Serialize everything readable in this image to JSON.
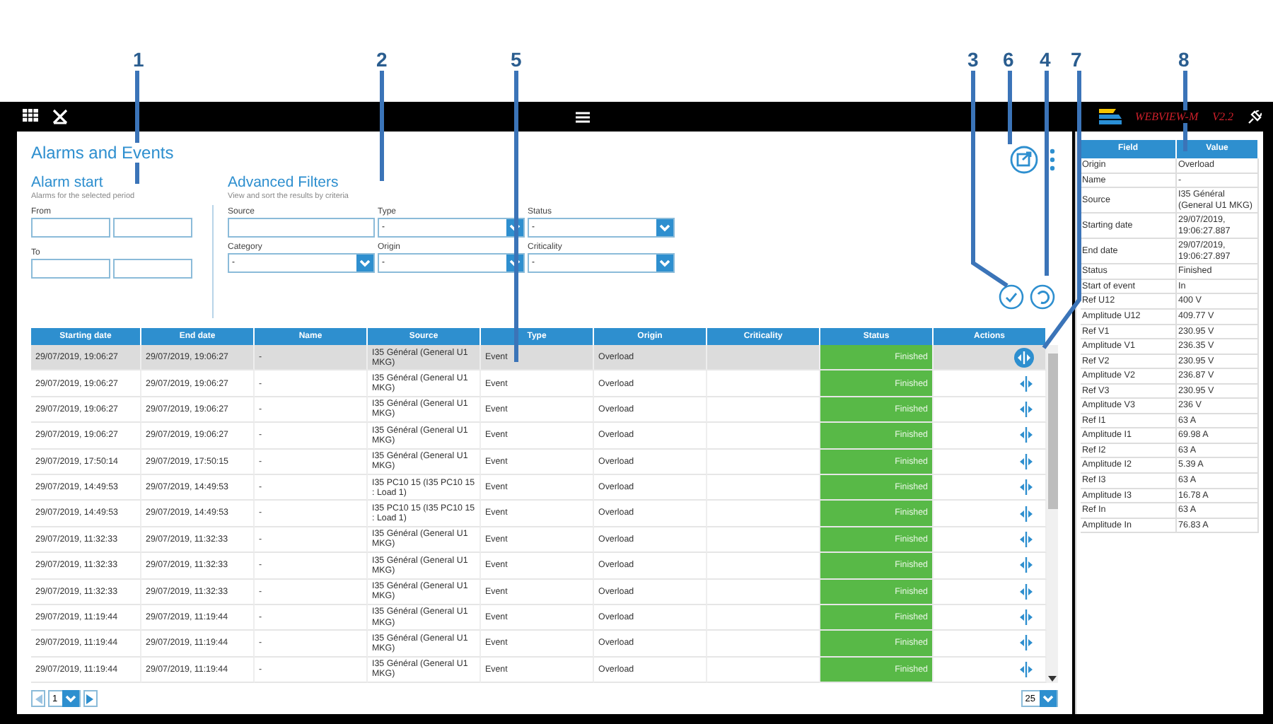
{
  "callouts": [
    "1",
    "2",
    "5",
    "3",
    "6",
    "4",
    "7",
    "8"
  ],
  "topbar": {
    "brand": "WEBVIEW-M",
    "version": "V2.2"
  },
  "title": "Alarms and Events",
  "alarm_start": {
    "title": "Alarm start",
    "subtitle": "Alarms for the selected period",
    "from_label": "From",
    "to_label": "To"
  },
  "filters": {
    "title": "Advanced Filters",
    "subtitle": "View and sort the results by criteria",
    "fields": [
      {
        "label": "Source",
        "kind": "text"
      },
      {
        "label": "Type",
        "kind": "select",
        "value": "-"
      },
      {
        "label": "Status",
        "kind": "select",
        "value": "-"
      },
      {
        "label": "Category",
        "kind": "select",
        "value": "-"
      },
      {
        "label": "Origin",
        "kind": "select",
        "value": "-"
      },
      {
        "label": "Criticality",
        "kind": "select",
        "value": "-"
      }
    ]
  },
  "table": {
    "columns": [
      "Starting date",
      "End date",
      "Name",
      "Source",
      "Type",
      "Origin",
      "Criticality",
      "Status",
      "Actions"
    ],
    "rows": [
      {
        "selected": true,
        "start": "29/07/2019, 19:06:27",
        "end": "29/07/2019, 19:06:27",
        "name": "-",
        "source": "I35 Général (General U1 MKG)",
        "type": "Event",
        "origin": "Overload",
        "status": "Finished"
      },
      {
        "selected": false,
        "start": "29/07/2019, 19:06:27",
        "end": "29/07/2019, 19:06:27",
        "name": "-",
        "source": "I35 Général (General U1 MKG)",
        "type": "Event",
        "origin": "Overload",
        "status": "Finished"
      },
      {
        "selected": false,
        "start": "29/07/2019, 19:06:27",
        "end": "29/07/2019, 19:06:27",
        "name": "-",
        "source": "I35 Général (General U1 MKG)",
        "type": "Event",
        "origin": "Overload",
        "status": "Finished"
      },
      {
        "selected": false,
        "start": "29/07/2019, 19:06:27",
        "end": "29/07/2019, 19:06:27",
        "name": "-",
        "source": "I35 Général (General U1 MKG)",
        "type": "Event",
        "origin": "Overload",
        "status": "Finished"
      },
      {
        "selected": false,
        "start": "29/07/2019, 17:50:14",
        "end": "29/07/2019, 17:50:15",
        "name": "-",
        "source": "I35 Général (General U1 MKG)",
        "type": "Event",
        "origin": "Overload",
        "status": "Finished"
      },
      {
        "selected": false,
        "start": "29/07/2019, 14:49:53",
        "end": "29/07/2019, 14:49:53",
        "name": "-",
        "source": "I35 PC10 15 (I35 PC10 15 : Load 1)",
        "type": "Event",
        "origin": "Overload",
        "status": "Finished"
      },
      {
        "selected": false,
        "start": "29/07/2019, 14:49:53",
        "end": "29/07/2019, 14:49:53",
        "name": "-",
        "source": "I35 PC10 15 (I35 PC10 15 : Load 1)",
        "type": "Event",
        "origin": "Overload",
        "status": "Finished"
      },
      {
        "selected": false,
        "start": "29/07/2019, 11:32:33",
        "end": "29/07/2019, 11:32:33",
        "name": "-",
        "source": "I35 Général (General U1 MKG)",
        "type": "Event",
        "origin": "Overload",
        "status": "Finished"
      },
      {
        "selected": false,
        "start": "29/07/2019, 11:32:33",
        "end": "29/07/2019, 11:32:33",
        "name": "-",
        "source": "I35 Général (General U1 MKG)",
        "type": "Event",
        "origin": "Overload",
        "status": "Finished"
      },
      {
        "selected": false,
        "start": "29/07/2019, 11:32:33",
        "end": "29/07/2019, 11:32:33",
        "name": "-",
        "source": "I35 Général (General U1 MKG)",
        "type": "Event",
        "origin": "Overload",
        "status": "Finished"
      },
      {
        "selected": false,
        "start": "29/07/2019, 11:19:44",
        "end": "29/07/2019, 11:19:44",
        "name": "-",
        "source": "I35 Général (General U1 MKG)",
        "type": "Event",
        "origin": "Overload",
        "status": "Finished"
      },
      {
        "selected": false,
        "start": "29/07/2019, 11:19:44",
        "end": "29/07/2019, 11:19:44",
        "name": "-",
        "source": "I35 Général (General U1 MKG)",
        "type": "Event",
        "origin": "Overload",
        "status": "Finished"
      },
      {
        "selected": false,
        "start": "29/07/2019, 11:19:44",
        "end": "29/07/2019, 11:19:44",
        "name": "-",
        "source": "I35 Général (General U1 MKG)",
        "type": "Event",
        "origin": "Overload",
        "status": "Finished"
      }
    ]
  },
  "pager": {
    "page": "1",
    "page_size": "25"
  },
  "details": {
    "columns": [
      "Field",
      "Value"
    ],
    "rows": [
      [
        "Origin",
        "Overload"
      ],
      [
        "Name",
        "-"
      ],
      [
        "Source",
        "I35 Général (General U1 MKG)"
      ],
      [
        "Starting date",
        "29/07/2019, 19:06:27.887"
      ],
      [
        "End date",
        "29/07/2019, 19:06:27.897"
      ],
      [
        "Status",
        "Finished"
      ],
      [
        "Start of event",
        "In"
      ],
      [
        "Ref U12",
        "400 V"
      ],
      [
        "Amplitude U12",
        "409.77 V"
      ],
      [
        "Ref V1",
        "230.95 V"
      ],
      [
        "Amplitude V1",
        "236.35 V"
      ],
      [
        "Ref V2",
        "230.95 V"
      ],
      [
        "Amplitude V2",
        "236.87 V"
      ],
      [
        "Ref V3",
        "230.95 V"
      ],
      [
        "Amplitude V3",
        "236 V"
      ],
      [
        "Ref I1",
        "63 A"
      ],
      [
        "Amplitude I1",
        "69.98 A"
      ],
      [
        "Ref I2",
        "63 A"
      ],
      [
        "Amplitude I2",
        "5.39 A"
      ],
      [
        "Ref I3",
        "63 A"
      ],
      [
        "Amplitude I3",
        "16.78 A"
      ],
      [
        "Ref In",
        "63 A"
      ],
      [
        "Amplitude In",
        "76.83 A"
      ]
    ]
  }
}
